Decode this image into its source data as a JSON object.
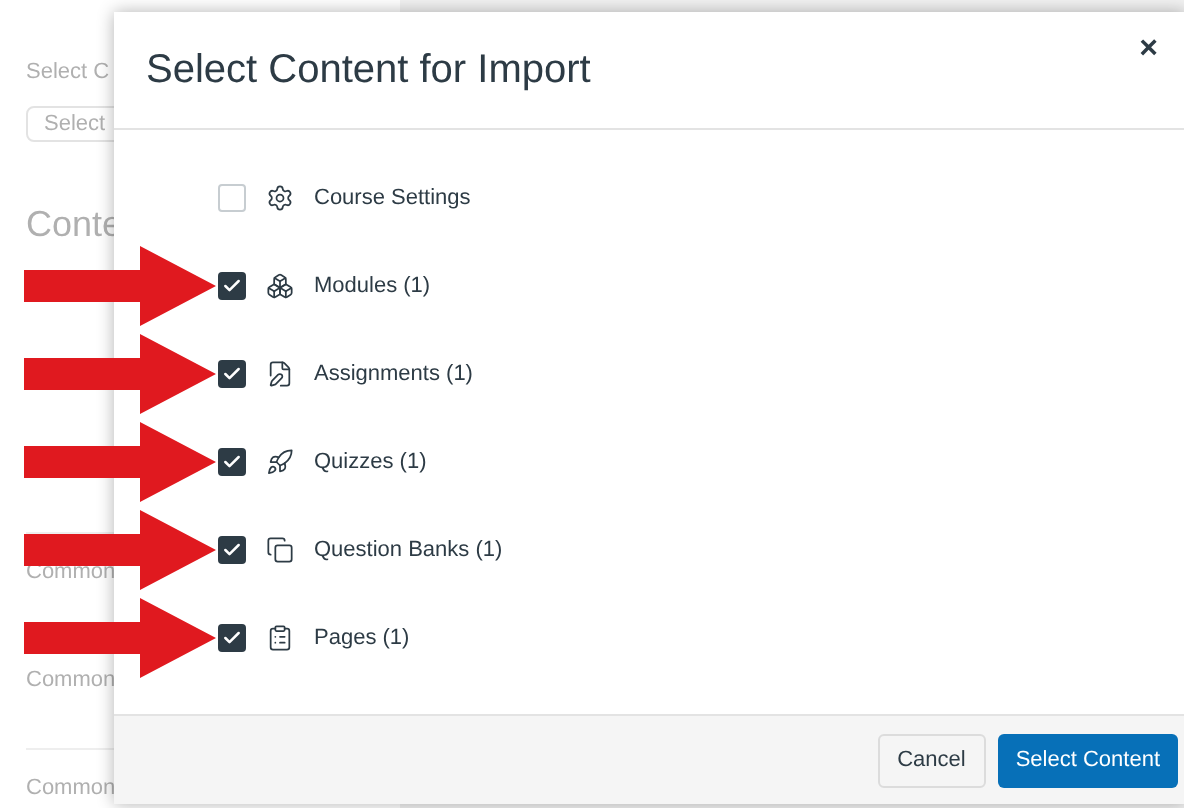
{
  "background_page": {
    "section_label": "Select C",
    "select_placeholder": "Select",
    "heading": "Conte",
    "rows": [
      "Common",
      "Common",
      "Common"
    ]
  },
  "dialog": {
    "title": "Select Content for Import",
    "close": "×",
    "items": [
      {
        "label": "Course Settings",
        "checked": false,
        "arrow": false
      },
      {
        "label": "Modules (1)",
        "checked": true,
        "arrow": true
      },
      {
        "label": "Assignments (1)",
        "checked": true,
        "arrow": true
      },
      {
        "label": "Quizzes (1)",
        "checked": true,
        "arrow": true
      },
      {
        "label": "Question Banks (1)",
        "checked": true,
        "arrow": true
      },
      {
        "label": "Pages (1)",
        "checked": true,
        "arrow": true
      }
    ],
    "buttons": [
      {
        "label": "Cancel",
        "kind": "secondary"
      },
      {
        "label": "Select Content",
        "kind": "primary"
      }
    ]
  }
}
